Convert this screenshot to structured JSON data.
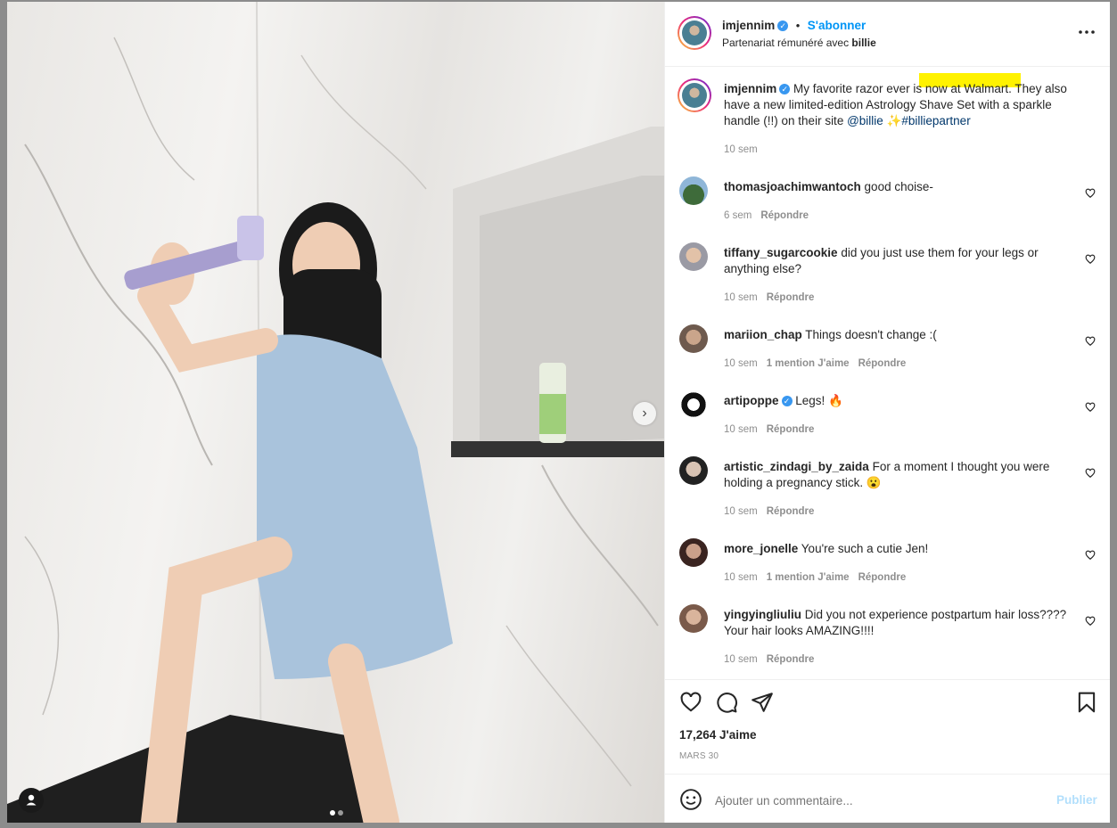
{
  "header": {
    "username": "imjennim",
    "follow_label": "S'abonner",
    "partnership_prefix": "Partenariat rémunéré avec",
    "partner": "billie",
    "more_icon": "more-horizontal-icon"
  },
  "caption": {
    "username": "imjennim",
    "text": "My favorite razor ever is now at Walmart. They also have a new limited-edition Astrology Shave Set with a sparkle handle (!!) on their site",
    "mention": "@billie",
    "emoji": "✨",
    "hashtag": "#billiepartner",
    "time": "10 sem",
    "highlight_color": "#fff200"
  },
  "comments": [
    {
      "username": "thomasjoachimwantoch",
      "text": "good choise-",
      "time": "6 sem",
      "likes": "",
      "reply": "Répondre",
      "verified": false
    },
    {
      "username": "tiffany_sugarcookie",
      "text": "did you just use them for your legs or anything else?",
      "time": "10 sem",
      "likes": "",
      "reply": "Répondre",
      "verified": false
    },
    {
      "username": "mariion_chap",
      "text": "Things doesn't change :(",
      "time": "10 sem",
      "likes": "1 mention J'aime",
      "reply": "Répondre",
      "verified": false
    },
    {
      "username": "artipoppe",
      "text": "Legs! 🔥",
      "time": "10 sem",
      "likes": "",
      "reply": "Répondre",
      "verified": true
    },
    {
      "username": "artistic_zindagi_by_zaida",
      "text": "For a moment I thought you were holding a pregnancy stick. 😮",
      "time": "10 sem",
      "likes": "",
      "reply": "Répondre",
      "verified": false
    },
    {
      "username": "more_jonelle",
      "text": "You're such a cutie Jen!",
      "time": "10 sem",
      "likes": "1 mention J'aime",
      "reply": "Répondre",
      "verified": false
    },
    {
      "username": "yingyingliuliu",
      "text": "Did you not experience postpartum hair loss???? Your hair looks AMAZING!!!!",
      "time": "10 sem",
      "likes": "",
      "reply": "Répondre",
      "verified": false
    }
  ],
  "actions": {
    "icons": [
      "heart-icon",
      "comment-icon",
      "share-icon",
      "bookmark-icon"
    ],
    "likes": "17,264 J'aime",
    "date": "MARS 30"
  },
  "add_comment": {
    "placeholder": "Ajouter un commentaire...",
    "publish": "Publier",
    "emoji_icon": "emoji-icon"
  },
  "carousel": {
    "slide_count": 2,
    "current_slide": 1
  },
  "colors": {
    "link": "#00376b",
    "publish_disabled": "#b2dffc",
    "verified": "#3897f0",
    "follow": "#0095f6"
  }
}
